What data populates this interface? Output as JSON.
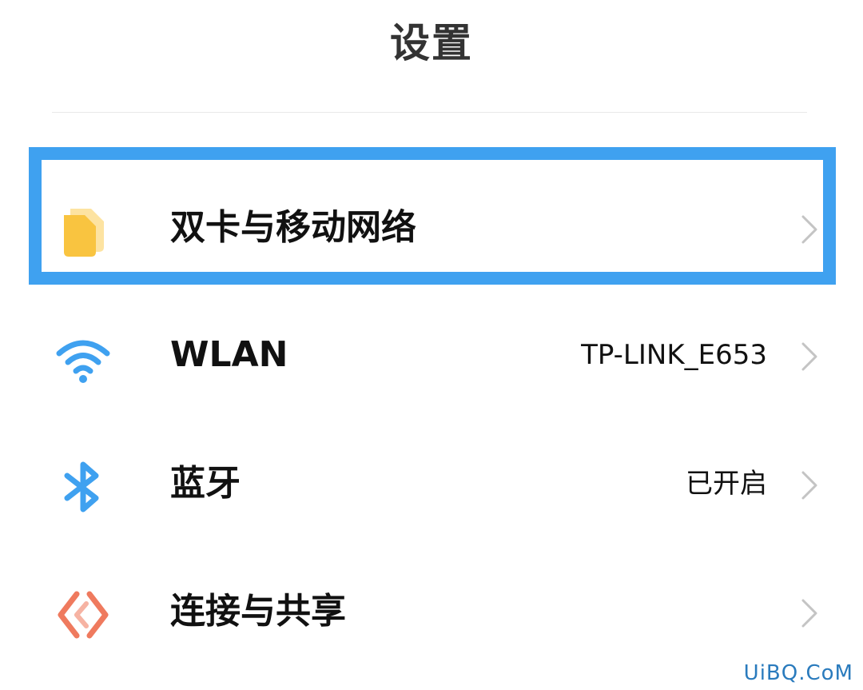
{
  "header": {
    "title": "设置"
  },
  "highlight_color": "#3fa1f0",
  "settings": [
    {
      "label": "双卡与移动网络",
      "value": "",
      "icon": "sim-card-icon",
      "icon_color": "#f9c440"
    },
    {
      "label": "WLAN",
      "value": "TP-LINK_E653",
      "icon": "wifi-icon",
      "icon_color": "#3fa1f0"
    },
    {
      "label": "蓝牙",
      "value": "已开启",
      "icon": "bluetooth-icon",
      "icon_color": "#3fa1f0"
    },
    {
      "label": "连接与共享",
      "value": "",
      "icon": "connection-share-icon",
      "icon_color": "#ef7a5e"
    }
  ],
  "watermark": "UiBQ.CoM"
}
